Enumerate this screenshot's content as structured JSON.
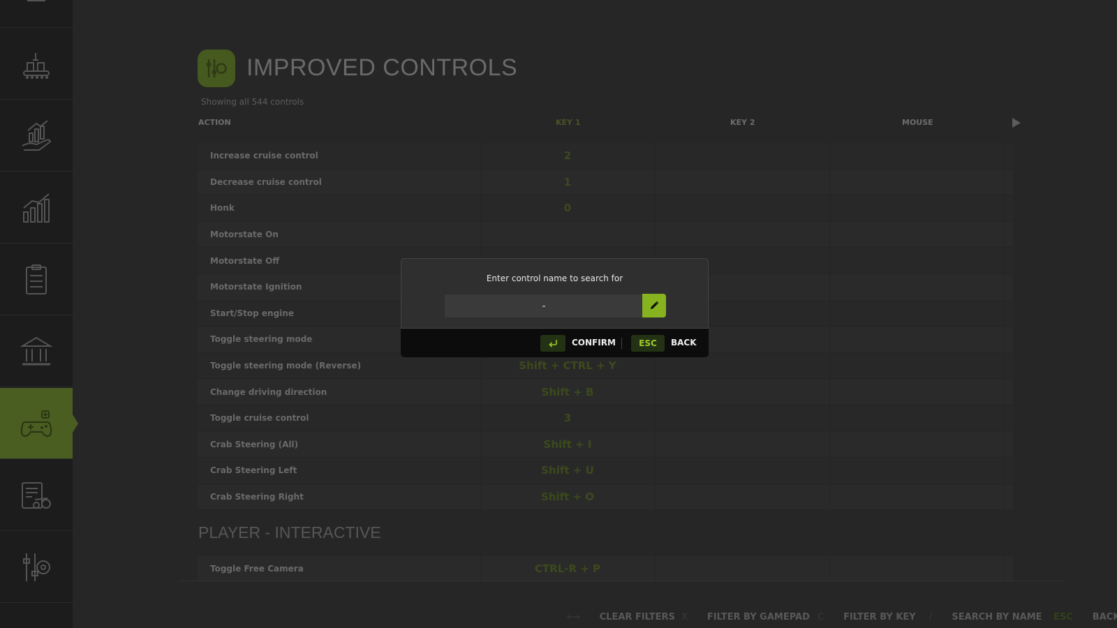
{
  "header": {
    "title": "IMPROVED CONTROLS",
    "subtitle": "Showing all 544 controls"
  },
  "columns": {
    "action": "ACTION",
    "key1": "KEY 1",
    "key2": "KEY 2",
    "mouse": "MOUSE"
  },
  "rows": [
    {
      "action": "Increase cruise control",
      "key1": "2"
    },
    {
      "action": "Decrease cruise control",
      "key1": "1"
    },
    {
      "action": "Honk",
      "key1": "0"
    },
    {
      "action": "Motorstate On",
      "key1": ""
    },
    {
      "action": "Motorstate Off",
      "key1": ""
    },
    {
      "action": "Motorstate Ignition",
      "key1": ""
    },
    {
      "action": "Start/Stop engine",
      "key1": ""
    },
    {
      "action": "Toggle steering mode",
      "key1": ""
    },
    {
      "action": "Toggle steering mode (Reverse)",
      "key1": "Shift + CTRL + Y"
    },
    {
      "action": "Change driving direction",
      "key1": "Shift + B"
    },
    {
      "action": "Toggle cruise control",
      "key1": "3"
    },
    {
      "action": "Crab Steering (All)",
      "key1": "Shift + I"
    },
    {
      "action": "Crab Steering Left",
      "key1": "Shift + U"
    },
    {
      "action": "Crab Steering Right",
      "key1": "Shift + O"
    }
  ],
  "section": {
    "title": "PLAYER - INTERACTIVE",
    "row": {
      "action": "Toggle Free Camera",
      "key1": "CTRL-R + P"
    }
  },
  "footer": {
    "clear_key": "⟷",
    "clear": "CLEAR FILTERS",
    "gamepad_key": "X",
    "gamepad": "FILTER BY GAMEPAD",
    "key_key": "C",
    "key": "FILTER BY KEY",
    "search_key": "/",
    "search": "SEARCH BY NAME",
    "back_key": "ESC",
    "back": "BACK"
  },
  "modal": {
    "prompt": "Enter control name to search for",
    "input_value": "-",
    "confirm_label": "CONFIRM",
    "esc_key": "ESC",
    "back_label": "BACK"
  },
  "colors": {
    "accent": "#86b31f",
    "active_sidebar": "#4a5e22"
  }
}
